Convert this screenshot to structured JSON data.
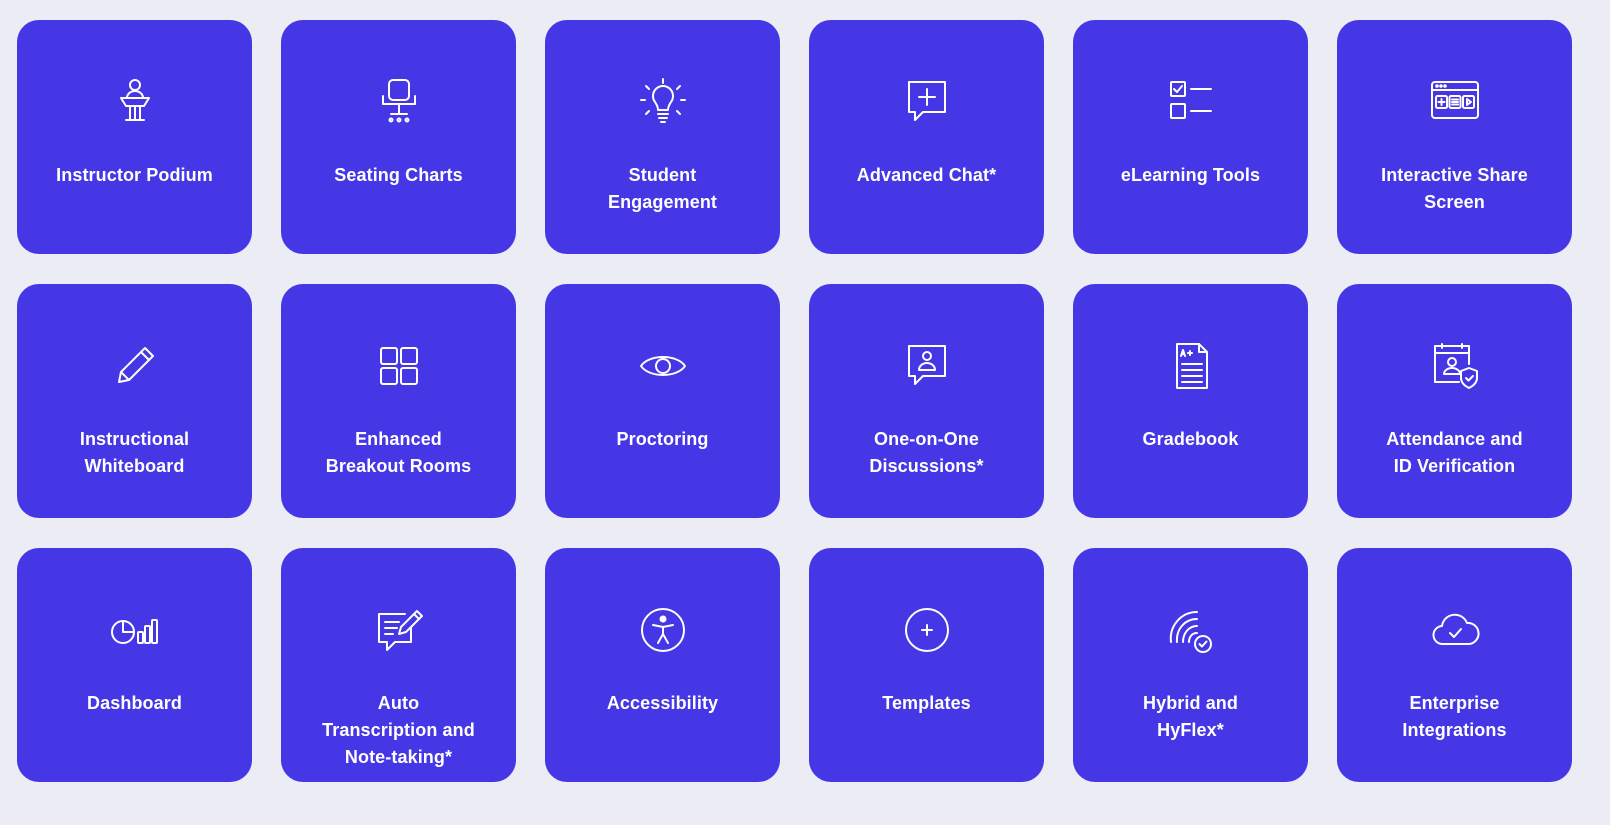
{
  "theme": {
    "background": "#ececf5",
    "tile_color": "#4536e6",
    "text_color": "#ffffff"
  },
  "tiles": [
    {
      "label": "Instructor Podium",
      "icon": "podium-icon"
    },
    {
      "label": "Seating Charts",
      "icon": "chair-icon"
    },
    {
      "label": "Student\nEngagement",
      "icon": "lightbulb-icon"
    },
    {
      "label": "Advanced Chat*",
      "icon": "chat-plus-icon"
    },
    {
      "label": "eLearning Tools",
      "icon": "checklist-icon"
    },
    {
      "label": "Interactive Share\nScreen",
      "icon": "browser-controls-icon"
    },
    {
      "label": "Instructional\nWhiteboard",
      "icon": "pencil-icon"
    },
    {
      "label": "Enhanced\nBreakout Rooms",
      "icon": "grid-icon"
    },
    {
      "label": "Proctoring",
      "icon": "eye-icon"
    },
    {
      "label": "One-on-One\nDiscussions*",
      "icon": "chat-user-icon"
    },
    {
      "label": "Gradebook",
      "icon": "grade-document-icon"
    },
    {
      "label": "Attendance and\nID Verification",
      "icon": "id-shield-icon"
    },
    {
      "label": "Dashboard",
      "icon": "pie-bars-icon"
    },
    {
      "label": "Auto\nTranscription and\nNote-taking*",
      "icon": "note-pen-icon"
    },
    {
      "label": "Accessibility",
      "icon": "accessibility-icon"
    },
    {
      "label": "Templates",
      "icon": "plus-circle-icon"
    },
    {
      "label": "Hybrid and\nHyFlex*",
      "icon": "signal-check-icon"
    },
    {
      "label": "Enterprise\nIntegrations",
      "icon": "cloud-check-icon"
    }
  ]
}
